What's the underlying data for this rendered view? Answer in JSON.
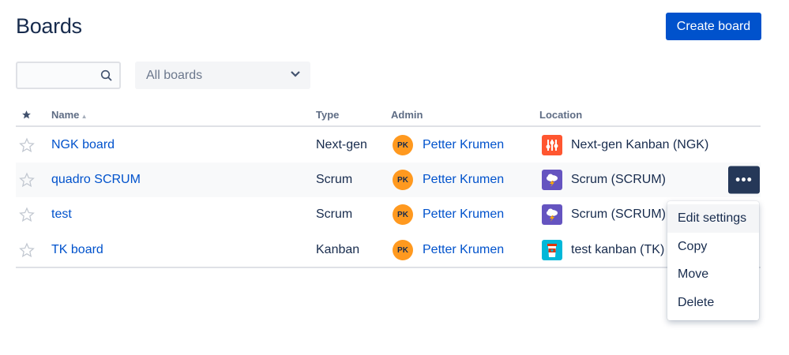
{
  "page": {
    "title": "Boards",
    "create_label": "Create board"
  },
  "filters": {
    "search_placeholder": "",
    "board_filter": "All boards"
  },
  "table": {
    "headers": {
      "name": "Name",
      "type": "Type",
      "admin": "Admin",
      "location": "Location"
    },
    "rows": [
      {
        "name": "NGK board",
        "type": "Next-gen",
        "admin_initials": "PK",
        "admin": "Petter Krumen",
        "location": "Next-gen Kanban (NGK)",
        "icon": "sliders-icon",
        "icon_color": "#ff5630"
      },
      {
        "name": "quadro SCRUM",
        "type": "Scrum",
        "admin_initials": "PK",
        "admin": "Petter Krumen",
        "location": "Scrum (SCRUM)",
        "icon": "storm-cloud-icon",
        "icon_color": "#6554c0"
      },
      {
        "name": "test",
        "type": "Scrum",
        "admin_initials": "PK",
        "admin": "Petter Krumen",
        "location": "Scrum (SCRUM)",
        "icon": "storm-cloud-icon",
        "icon_color": "#6554c0"
      },
      {
        "name": "TK board",
        "type": "Kanban",
        "admin_initials": "PK",
        "admin": "Petter Krumen",
        "location": "test kanban (TK)",
        "icon": "coffee-cup-icon",
        "icon_color": "#00b8d9"
      }
    ]
  },
  "menu": {
    "more_label": "•••",
    "items": [
      "Edit settings",
      "Copy",
      "Move",
      "Delete"
    ]
  }
}
